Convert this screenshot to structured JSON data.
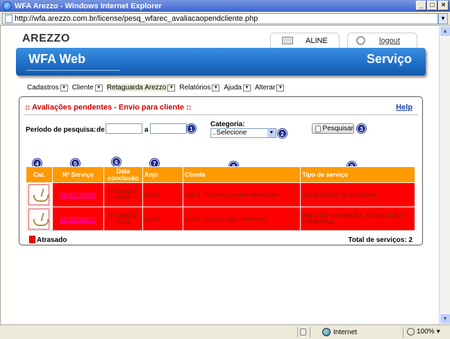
{
  "window": {
    "title": "WFA Arezzo - Windows Internet Explorer",
    "url": "http://wfa.arezzo.com.br/license/pesq_wfarec_avaliacaopendcliente.php"
  },
  "header": {
    "brand": "AREZZO",
    "user": "ALINE",
    "logout": "logout",
    "banner_left": "WFA Web",
    "banner_right": "Serviço"
  },
  "menu": [
    {
      "label": "Cadastros"
    },
    {
      "label": "Cliente"
    },
    {
      "label": "Retaguarda Arezzo"
    },
    {
      "label": "Relatórios"
    },
    {
      "label": "Ajuda"
    },
    {
      "label": "Alterar"
    }
  ],
  "panel": {
    "title": ":: Avaliações pendentes - Envio para cliente ::",
    "help": "Help",
    "search_label": "Período de pesquisa:",
    "from_label": "de",
    "to_label": "a",
    "from_value": "",
    "to_value": "",
    "category_label": "Categoria:",
    "category_value": "..Selecione",
    "search_button": "Pesquisar"
  },
  "badges": [
    "1",
    "2",
    "3",
    "4",
    "5",
    "6",
    "7",
    "8",
    "9"
  ],
  "table": {
    "headers": [
      "Cat.",
      "Nº Serviço",
      "Data conclusão",
      "Anjo",
      "Cliente",
      "Tipo de serviço"
    ],
    "rows": [
      {
        "service": "510817:00006",
        "date": "07/08/2007",
        "time": "09:29",
        "anjo": "ALINE",
        "cliente": "10817 - Rosa de Lourdes Marim Poffo",
        "tipo": "SOLICITAÇÃO DE MATERIAL"
      },
      {
        "service": "517355:00010",
        "date": "17/08/2007",
        "time": "15:21",
        "anjo": "ALINE",
        "cliente": "17355 - Erica E. Dias Pereira-me",
        "tipo": "ERRO DE EXPEDIÇÃO - DEVOLUÇÃO COMERCIAL"
      }
    ]
  },
  "footer": {
    "legend": "Atrasado",
    "total_label": "Total de serviços:",
    "total_value": "2"
  },
  "statusbar": {
    "zone": "Internet",
    "zoom": "100%"
  },
  "colors": {
    "header_orange": "#ff9900",
    "row_red": "#ff0000",
    "title_red": "#cc0000",
    "banner_blue": "#1f6ec7"
  }
}
